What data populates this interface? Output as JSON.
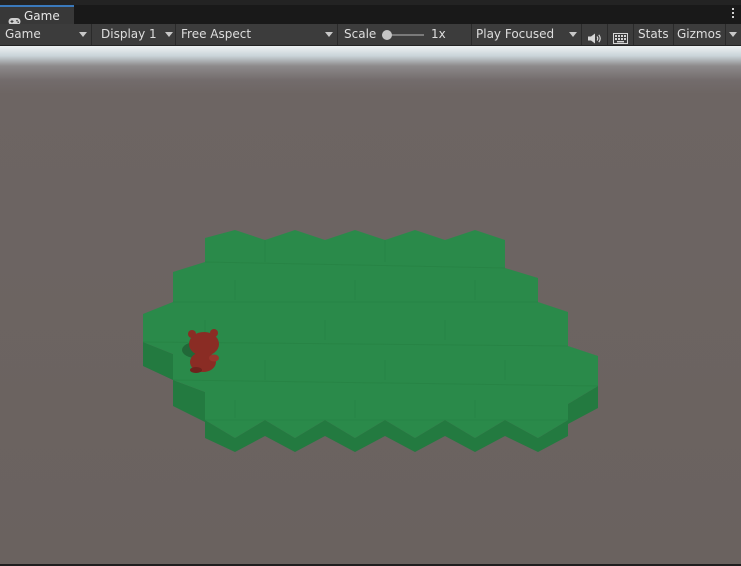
{
  "tab": {
    "title": "Game",
    "icon": "gamepad-icon"
  },
  "toolbar": {
    "view_mode": "Game",
    "display": "Display 1",
    "aspect": "Free Aspect",
    "scale_label": "Scale",
    "scale_value": "1x",
    "scale_level": 0.0,
    "play_mode": "Play Focused",
    "audio_icon": "speaker-icon",
    "keyboard_icon": "keyboard-icon",
    "stats": "Stats",
    "gizmos": "Gizmos"
  },
  "scene": {
    "ground_color": "#6a625f",
    "sky_color": "#eef2f3",
    "tile_top_color": "#2a8a4a",
    "tile_side_color": "#237a40",
    "character_color": "#8a2c24"
  }
}
